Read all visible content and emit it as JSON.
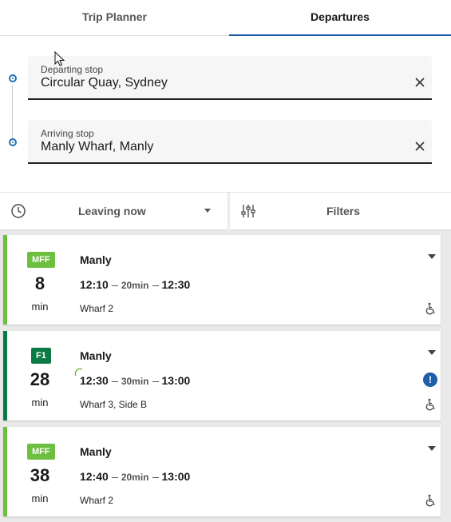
{
  "tabs": [
    {
      "label": "Trip Planner",
      "active": false
    },
    {
      "label": "Departures",
      "active": true
    }
  ],
  "search": {
    "departing": {
      "label": "Departing stop",
      "value": "Circular Quay, Sydney"
    },
    "arriving": {
      "label": "Arriving stop",
      "value": "Manly Wharf, Manly"
    }
  },
  "filter_bar": {
    "time_option": "Leaving now",
    "filters_label": "Filters"
  },
  "departures": [
    {
      "badge": "MFF",
      "minutes": "8",
      "min_label": "min",
      "destination": "Manly",
      "depart": "12:10",
      "duration": "20min",
      "arrive": "12:30",
      "wharf": "Wharf 2"
    },
    {
      "badge": "F1",
      "minutes": "28",
      "min_label": "min",
      "destination": "Manly",
      "depart": "12:30",
      "duration": "30min",
      "arrive": "13:00",
      "wharf": "Wharf 3, Side B",
      "alert": "!"
    },
    {
      "badge": "MFF",
      "minutes": "38",
      "min_label": "min",
      "destination": "Manly",
      "depart": "12:40",
      "duration": "20min",
      "arrive": "13:00",
      "wharf": "Wharf 2"
    }
  ],
  "colors": {
    "accent": "#1f5ea8",
    "mff_green": "#6cbf3f",
    "f1_green": "#0c7a45"
  }
}
